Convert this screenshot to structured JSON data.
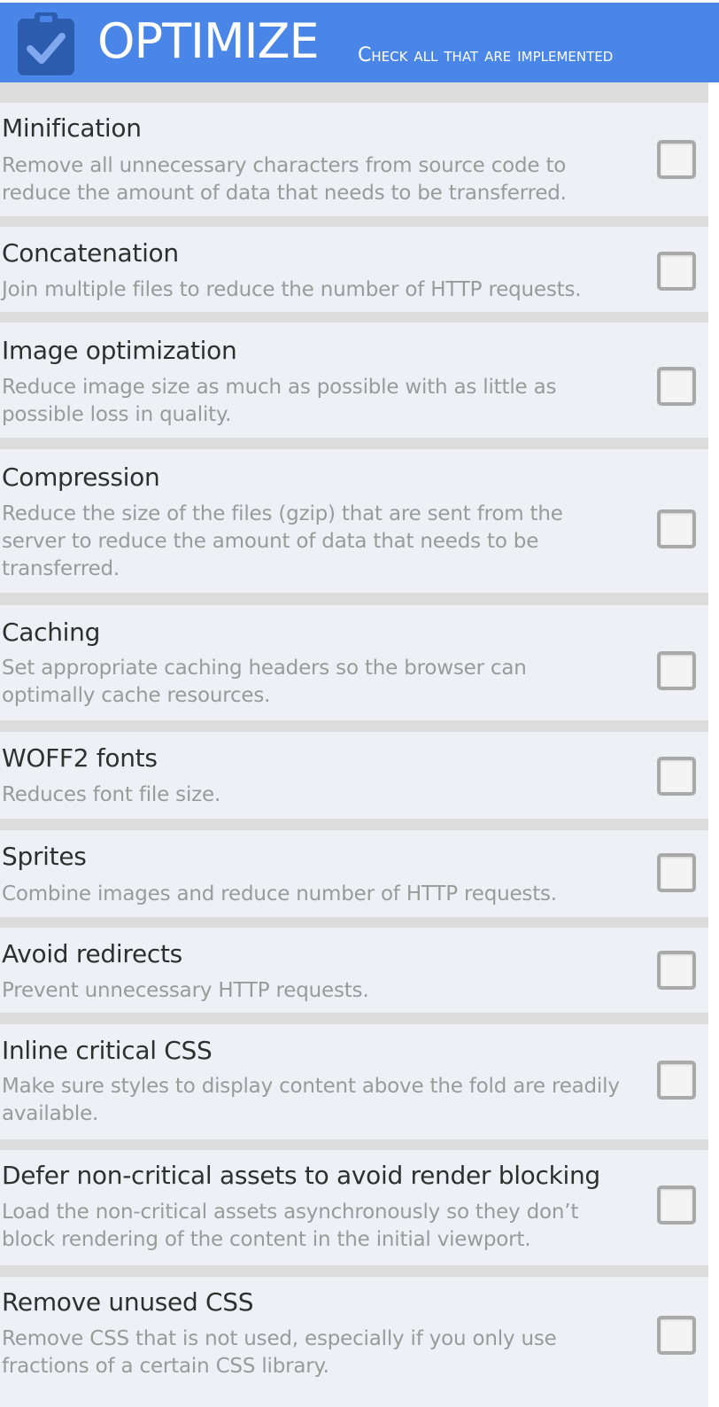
{
  "header": {
    "title": "OPTIMIZE",
    "subtitle": "Check all that are implemented",
    "icon": "clipboard-check-icon",
    "background_color": "#4a86e8"
  },
  "items": [
    {
      "title": "Minification",
      "description": "Remove all unnecessary characters from source code to reduce the amount of data that needs to be transferred.",
      "checked": false
    },
    {
      "title": "Concatenation",
      "description": "Join multiple files to reduce the number of HTTP requests.",
      "checked": false
    },
    {
      "title": "Image optimization",
      "description": "Reduce image size as much as possible with as little as possible loss in quality.",
      "checked": false
    },
    {
      "title": "Compression",
      "description": "Reduce the size of the files (gzip) that are sent from the server to reduce the amount of data that needs to be transferred.",
      "checked": false
    },
    {
      "title": "Caching",
      "description": "Set appropriate caching headers so the browser can optimally cache resources.",
      "checked": false
    },
    {
      "title": "WOFF2 fonts",
      "description": "Reduces font file size.",
      "checked": false
    },
    {
      "title": "Sprites",
      "description": "Combine images and reduce number of HTTP requests.",
      "checked": false
    },
    {
      "title": "Avoid redirects",
      "description": "Prevent unnecessary HTTP requests.",
      "checked": false
    },
    {
      "title": "Inline critical CSS",
      "description": "Make sure styles to display content above the fold are readily available.",
      "checked": false
    },
    {
      "title": "Defer non-critical assets to avoid render blocking",
      "description": "Load the non-critical assets asynchronously so they don’t block rendering of the content in the initial viewport.",
      "checked": false
    },
    {
      "title": "Remove unused CSS",
      "description": "Remove CSS that is not used, especially if you only use fractions of a certain CSS library.",
      "checked": false
    }
  ]
}
